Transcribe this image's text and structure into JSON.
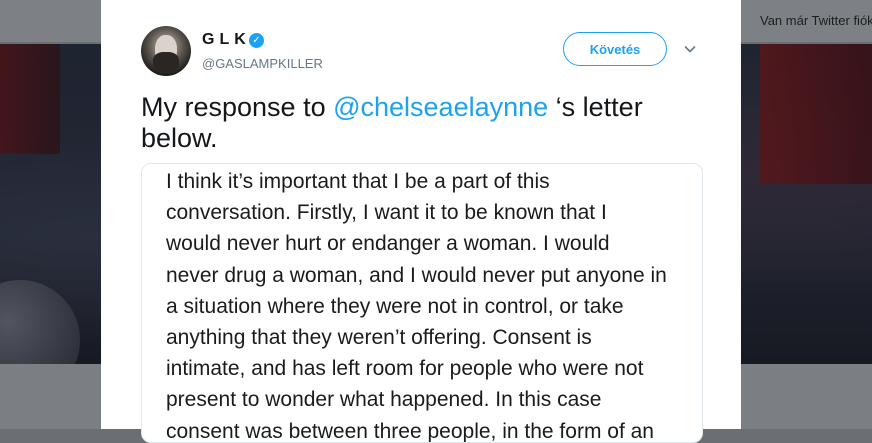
{
  "background": {
    "topbar_text": "Van már Twitter fiókod?"
  },
  "tweet": {
    "display_name": "GLK",
    "verified_glyph": "✓",
    "handle": "@GASLAMPKILLER",
    "follow_label": "Követés",
    "menu_icon": "chevron-down-icon",
    "text_prefix": "My response to ",
    "mention": "@chelseaelaynne",
    "text_suffix": " ‘s letter below."
  },
  "statement": {
    "lines": [
      "I think it’s important that I be a part of this",
      "conversation. Firstly, I want it to be known that I",
      "would never hurt or endanger a woman. I would",
      "never drug a woman, and I would never put anyone in",
      "a situation where they were not in control, or take",
      "anything that they weren’t offering. Consent is",
      "intimate, and has left room for people who were not",
      "present to wonder what happened. In this case",
      "consent was between three people, in the form of an"
    ]
  },
  "colors": {
    "accent": "#1da1f2",
    "text": "#14171a",
    "secondary": "#657786"
  }
}
